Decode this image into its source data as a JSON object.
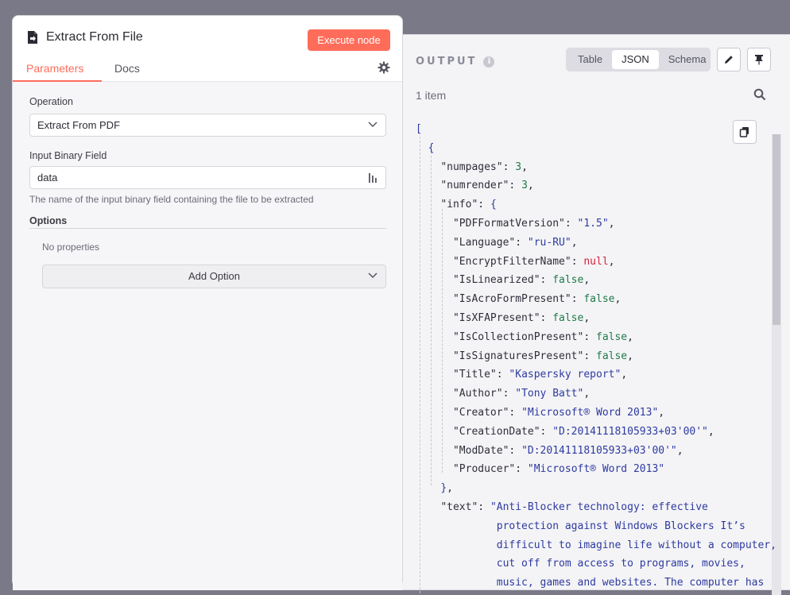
{
  "node": {
    "title": "Extract From File",
    "execute_label": "Execute node",
    "tabs": [
      "Parameters",
      "Docs"
    ],
    "active_tab": "Parameters"
  },
  "parameters": {
    "operation_label": "Operation",
    "operation_value": "Extract From PDF",
    "binary_field_label": "Input Binary Field",
    "binary_field_value": "data",
    "binary_field_hint": "The name of the input binary field containing the file to be extracted",
    "options_label": "Options",
    "no_properties": "No properties",
    "add_option_label": "Add Option"
  },
  "output": {
    "title": "OUTPUT",
    "info_glyph": "i",
    "views": [
      "Table",
      "JSON",
      "Schema"
    ],
    "active_view": "JSON",
    "item_count": "1 item",
    "icons": [
      "pencil-icon",
      "pin-icon",
      "search-icon",
      "copy-icon"
    ],
    "json": {
      "numpages": "3",
      "numrender": "3",
      "info": [
        {
          "k": "PDFFormatVersion",
          "v": "\"1.5\"",
          "t": "str"
        },
        {
          "k": "Language",
          "v": "\"ru-RU\"",
          "t": "str"
        },
        {
          "k": "EncryptFilterName",
          "v": "null",
          "t": "null"
        },
        {
          "k": "IsLinearized",
          "v": "false",
          "t": "bool"
        },
        {
          "k": "IsAcroFormPresent",
          "v": "false",
          "t": "bool"
        },
        {
          "k": "IsXFAPresent",
          "v": "false",
          "t": "bool"
        },
        {
          "k": "IsCollectionPresent",
          "v": "false",
          "t": "bool"
        },
        {
          "k": "IsSignaturesPresent",
          "v": "false",
          "t": "bool"
        },
        {
          "k": "Title",
          "v": "\"Kaspersky report\"",
          "t": "str"
        },
        {
          "k": "Author",
          "v": "\"Tony Batt\"",
          "t": "str"
        },
        {
          "k": "Creator",
          "v": "\"Microsoft® Word 2013\"",
          "t": "str"
        },
        {
          "k": "CreationDate",
          "v": "\"D:20141118105933+03'00'\"",
          "t": "str"
        },
        {
          "k": "ModDate",
          "v": "\"D:20141118105933+03'00'\"",
          "t": "str"
        },
        {
          "k": "Producer",
          "v": "\"Microsoft® Word 2013\"",
          "t": "str",
          "last": true
        }
      ],
      "text_lines": [
        "\"Anti-Blocker technology: effective",
        "protection against Windows Blockers It’s",
        "difficult to imagine life without a computer,",
        "cut off from access to programs, movies,",
        "music, games and websites. The computer has"
      ]
    }
  },
  "colors": {
    "accent": "#ff6d5a",
    "json_string": "#2e3aa0",
    "json_bool": "#1f7a4a",
    "json_null": "#d8203a"
  }
}
